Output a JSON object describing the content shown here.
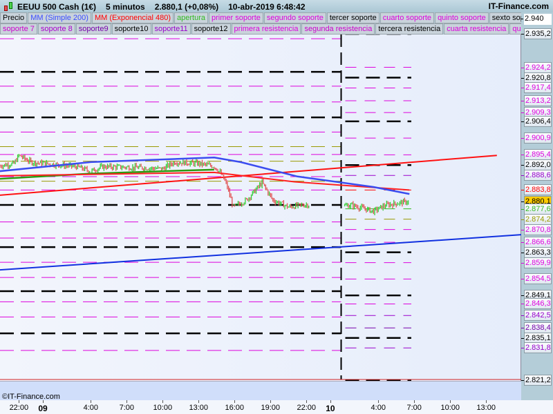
{
  "header": {
    "instrument": "EEUU 500 Cash (1€)",
    "timeframe": "5 minutos",
    "price": "2.880,1 (+0,08%)",
    "datetime": "10-abr-2019 6:48:42",
    "brand": "IT-Finance.com"
  },
  "legend_row1": [
    {
      "label": "Precio",
      "color": "#000000"
    },
    {
      "label": "MM (Simple 200)",
      "color": "#3b4cff"
    },
    {
      "label": "MM (Exponencial 480)",
      "color": "#ff0000"
    },
    {
      "label": "apertura",
      "color": "#33bb22"
    },
    {
      "label": "primer soporte",
      "color": "#dd00dd"
    },
    {
      "label": "segundo soporte",
      "color": "#dd00dd"
    },
    {
      "label": "tercer soporte",
      "color": "#000000"
    },
    {
      "label": "cuarto soporte",
      "color": "#dd00dd"
    },
    {
      "label": "quinto soporte",
      "color": "#dd00dd"
    },
    {
      "label": "sexto soporte",
      "color": "#000000"
    }
  ],
  "legend_row2": [
    {
      "label": "soporte 7",
      "color": "#cc00cc"
    },
    {
      "label": "soporte 8",
      "color": "#aa00cc"
    },
    {
      "label": "soporte9",
      "color": "#7700aa"
    },
    {
      "label": "soporte10",
      "color": "#000000"
    },
    {
      "label": "soporte11",
      "color": "#9900cc"
    },
    {
      "label": "soporte12",
      "color": "#000000"
    },
    {
      "label": "primera resistencia",
      "color": "#dd00dd"
    },
    {
      "label": "segunda resistencia",
      "color": "#cc00cc"
    },
    {
      "label": "tercera resistencia",
      "color": "#000000"
    },
    {
      "label": "cuarta resistencia",
      "color": "#dd00dd"
    },
    {
      "label": "quinta resi",
      "color": "#dd00dd"
    }
  ],
  "footer": {
    "copyright": "©IT-Finance.com"
  },
  "y_axis": {
    "range": [
      2821.2,
      2940
    ],
    "labels": [
      {
        "text": "2.940",
        "value": 2940,
        "color": "#000000",
        "plain": true
      },
      {
        "text": "2.935,2",
        "value": 2935.2,
        "color": "#000000"
      },
      {
        "text": "2.924,2",
        "value": 2924.2,
        "color": "#dd00dd"
      },
      {
        "text": "2.920,8",
        "value": 2920.8,
        "color": "#000000"
      },
      {
        "text": "2.917,4",
        "value": 2917.4,
        "color": "#dd00dd"
      },
      {
        "text": "2.913,2",
        "value": 2913.2,
        "color": "#dd00dd"
      },
      {
        "text": "2.909,3",
        "value": 2909.3,
        "color": "#dd00dd"
      },
      {
        "text": "2.906,4",
        "value": 2906.4,
        "color": "#000000"
      },
      {
        "text": "2.900,9",
        "value": 2900.9,
        "color": "#dd00dd"
      },
      {
        "text": "2.895,4",
        "value": 2895.4,
        "color": "#dd00dd"
      },
      {
        "text": "2.892,0",
        "value": 2892.0,
        "color": "#000000"
      },
      {
        "text": "2.888,6",
        "value": 2888.6,
        "color": "#9900cc"
      },
      {
        "text": "2.883,8",
        "value": 2883.8,
        "color": "#ff0000"
      },
      {
        "text": "2.880,1",
        "value": 2880.1,
        "color": "#000000",
        "current": true
      },
      {
        "text": "2.877,6",
        "value": 2877.6,
        "color": "#33bb22"
      },
      {
        "text": "2.874,2",
        "value": 2874.2,
        "color": "#999900"
      },
      {
        "text": "2.870,8",
        "value": 2870.8,
        "color": "#dd00dd"
      },
      {
        "text": "2.866,6",
        "value": 2866.6,
        "color": "#dd00dd"
      },
      {
        "text": "2.863,3",
        "value": 2863.3,
        "color": "#000000"
      },
      {
        "text": "2.859,9",
        "value": 2859.9,
        "color": "#dd00dd"
      },
      {
        "text": "2.854,5",
        "value": 2854.5,
        "color": "#dd00dd"
      },
      {
        "text": "2.849,1",
        "value": 2849.1,
        "color": "#000000"
      },
      {
        "text": "2.846,3",
        "value": 2846.3,
        "color": "#dd00dd"
      },
      {
        "text": "2.842,5",
        "value": 2842.5,
        "color": "#9900cc"
      },
      {
        "text": "2.838,4",
        "value": 2838.4,
        "color": "#7700aa"
      },
      {
        "text": "2.835,1",
        "value": 2835.1,
        "color": "#000000"
      },
      {
        "text": "2.831,8",
        "value": 2831.8,
        "color": "#9900cc"
      },
      {
        "text": "2.821,2",
        "value": 2821.2,
        "color": "#000000"
      }
    ]
  },
  "x_axis": {
    "range_hours": [
      -3.6,
      40
    ],
    "ticks": [
      {
        "label": "22:00",
        "h": -2
      },
      {
        "label": "09",
        "h": 0,
        "day": true
      },
      {
        "label": "4:00",
        "h": 4
      },
      {
        "label": "7:00",
        "h": 7
      },
      {
        "label": "10:00",
        "h": 10
      },
      {
        "label": "13:00",
        "h": 13
      },
      {
        "label": "16:00",
        "h": 16
      },
      {
        "label": "19:00",
        "h": 19
      },
      {
        "label": "22:00",
        "h": 22
      },
      {
        "label": "10",
        "h": 24,
        "day": true
      },
      {
        "label": "4:00",
        "h": 28
      },
      {
        "label": "7:00",
        "h": 31
      },
      {
        "label": "10:00",
        "h": 34
      },
      {
        "label": "13:00",
        "h": 37
      }
    ]
  },
  "chart_data": {
    "type": "candlestick",
    "session_break_h": 24.9,
    "price_path": [
      [
        -3.6,
        2891.8
      ],
      [
        -2.4,
        2892.5
      ],
      [
        -2,
        2895.2
      ],
      [
        -1,
        2893
      ],
      [
        1,
        2892.2
      ],
      [
        2.8,
        2891.5
      ],
      [
        4,
        2890.0
      ],
      [
        5,
        2891.5
      ],
      [
        8,
        2891.2
      ],
      [
        10,
        2890.8
      ],
      [
        11,
        2893.0
      ],
      [
        13,
        2892.5
      ],
      [
        14.3,
        2891.6
      ],
      [
        14.8,
        2889.6
      ],
      [
        15.3,
        2886
      ],
      [
        15.9,
        2878.2
      ],
      [
        17,
        2880.5
      ],
      [
        18.3,
        2886.2
      ],
      [
        19.2,
        2880.5
      ],
      [
        20.5,
        2878.2
      ],
      [
        22,
        2879
      ],
      [
        24.8,
        2878.5
      ],
      [
        25.8,
        2878.8
      ],
      [
        27.6,
        2876.8
      ],
      [
        28.6,
        2878.8
      ],
      [
        30.6,
        2880.1
      ]
    ],
    "sma200": [
      [
        -3.6,
        2890
      ],
      [
        4,
        2893
      ],
      [
        14.3,
        2894.5
      ],
      [
        16.5,
        2893
      ],
      [
        21.2,
        2888.3
      ],
      [
        27.6,
        2884.8
      ],
      [
        30.6,
        2882.5
      ]
    ],
    "ema480_line": [
      [
        -3.6,
        2888.5
      ],
      [
        14.3,
        2889.6
      ],
      [
        21,
        2886.5
      ],
      [
        30.6,
        2883.8
      ]
    ],
    "red_trend": [
      [
        -3.6,
        2882.1
      ],
      [
        37.9,
        2895.2
      ]
    ],
    "blue_trend": [
      [
        -3.6,
        2857.5
      ],
      [
        40,
        2869.1
      ]
    ],
    "levels_prev_day": [
      {
        "p": 2937.9,
        "c": "#dd00dd"
      },
      {
        "p": 2933.6,
        "c": "#dd00dd"
      },
      {
        "p": 2922.7,
        "c": "#000000"
      },
      {
        "p": 2918,
        "c": "#dd00dd"
      },
      {
        "p": 2912.8,
        "c": "#dd00dd"
      },
      {
        "p": 2907.7,
        "c": "#000000"
      },
      {
        "p": 2902.9,
        "c": "#dd00dd"
      },
      {
        "p": 2898.1,
        "c": "#999900"
      },
      {
        "p": 2895.5,
        "c": "#dd00dd"
      },
      {
        "p": 2893.3,
        "c": "#999900"
      },
      {
        "p": 2888.2,
        "c": "#dd00dd"
      },
      {
        "p": 2886.7,
        "c": "#999900"
      },
      {
        "p": 2883.8,
        "c": "#dd00dd"
      },
      {
        "p": 2878.9,
        "c": "#000000"
      },
      {
        "p": 2873.3,
        "c": "#dd00dd"
      },
      {
        "p": 2868,
        "c": "#dd00dd"
      },
      {
        "p": 2865.0,
        "c": "#000000"
      },
      {
        "p": 2860,
        "c": "#dd00dd"
      },
      {
        "p": 2855,
        "c": "#dd00dd"
      },
      {
        "p": 2850.5,
        "c": "#000000"
      },
      {
        "p": 2847,
        "c": "#dd00dd"
      },
      {
        "p": 2842,
        "c": "#dd00dd"
      },
      {
        "p": 2836.6,
        "c": "#000000"
      },
      {
        "p": 2831,
        "c": "#dd00dd"
      }
    ]
  }
}
